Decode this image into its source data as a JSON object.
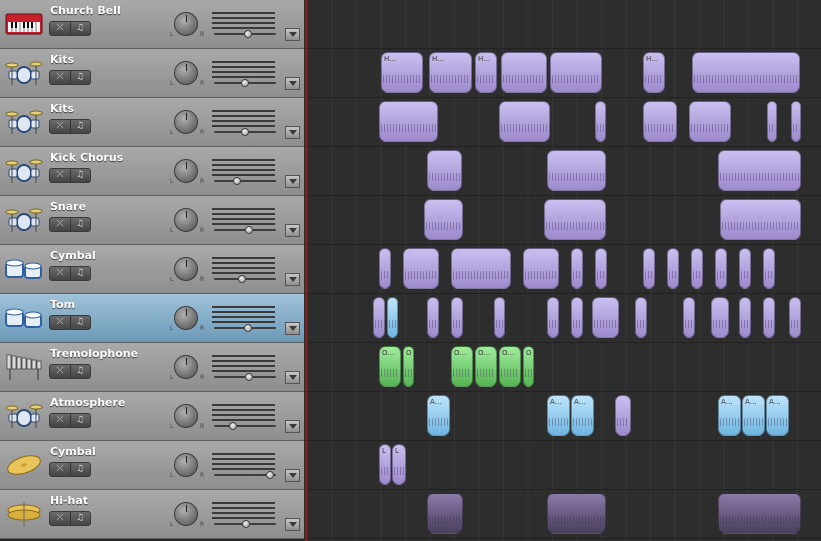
{
  "tracks": [
    {
      "name": "Church Bell",
      "icon": "keyboard-icon",
      "volume": 0.55,
      "selected": false
    },
    {
      "name": "Kits",
      "icon": "drum-kit-icon",
      "volume": 0.5,
      "selected": false
    },
    {
      "name": "Kits",
      "icon": "drum-kit-icon",
      "volume": 0.5,
      "selected": false
    },
    {
      "name": "Kick Chorus",
      "icon": "drum-kit-icon",
      "volume": 0.37,
      "selected": false
    },
    {
      "name": "Snare",
      "icon": "drum-kit-icon",
      "volume": 0.57,
      "selected": false
    },
    {
      "name": "Cymbal",
      "icon": "tom-drums-icon",
      "volume": 0.45,
      "selected": false
    },
    {
      "name": "Tom",
      "icon": "tom-drums-icon",
      "volume": 0.55,
      "selected": true
    },
    {
      "name": "Tremolophone",
      "icon": "vibraphone-icon",
      "volume": 0.57,
      "selected": false
    },
    {
      "name": "Atmosphere",
      "icon": "drum-kit-icon",
      "volume": 0.3,
      "selected": false
    },
    {
      "name": "Cymbal",
      "icon": "cymbal-icon",
      "volume": 0.9,
      "selected": false
    },
    {
      "name": "Hi-hat",
      "icon": "hi-hat-icon",
      "volume": 0.52,
      "selected": false
    }
  ],
  "controls": {
    "mute_glyph": "⤫",
    "solo_glyph": "♫",
    "pan_left": "L",
    "pan_right": "R"
  },
  "colors": {
    "purple": "#b3a3e3",
    "dark": "#5e5070",
    "green": "#7fd17c",
    "blue": "#93cbee",
    "playhead": "#8b1c1c"
  },
  "lanes": [
    [],
    [
      {
        "start": 74,
        "end": 116,
        "color": "purple",
        "label": "H…"
      },
      {
        "start": 122,
        "end": 165,
        "color": "purple",
        "label": "H…"
      },
      {
        "start": 168,
        "end": 190,
        "color": "purple",
        "label": "H…"
      },
      {
        "start": 194,
        "end": 240,
        "color": "purple",
        "label": ""
      },
      {
        "start": 243,
        "end": 295,
        "color": "purple",
        "label": ""
      },
      {
        "start": 336,
        "end": 358,
        "color": "purple",
        "label": "H…"
      },
      {
        "start": 385,
        "end": 493,
        "color": "purple",
        "label": ""
      }
    ],
    [
      {
        "start": 72,
        "end": 131,
        "color": "purple",
        "label": ""
      },
      {
        "start": 192,
        "end": 243,
        "color": "purple",
        "label": ""
      },
      {
        "start": 288,
        "end": 299,
        "color": "purple",
        "label": ""
      },
      {
        "start": 336,
        "end": 370,
        "color": "purple",
        "label": ""
      },
      {
        "start": 382,
        "end": 424,
        "color": "purple",
        "label": ""
      },
      {
        "start": 460,
        "end": 470,
        "color": "purple",
        "label": ""
      },
      {
        "start": 484,
        "end": 494,
        "color": "purple",
        "label": ""
      }
    ],
    [
      {
        "start": 120,
        "end": 155,
        "color": "purple",
        "label": ""
      },
      {
        "start": 240,
        "end": 299,
        "color": "purple",
        "label": ""
      },
      {
        "start": 411,
        "end": 494,
        "color": "purple",
        "label": ""
      }
    ],
    [
      {
        "start": 117,
        "end": 156,
        "color": "purple",
        "label": ""
      },
      {
        "start": 237,
        "end": 299,
        "color": "purple",
        "label": ""
      },
      {
        "start": 413,
        "end": 494,
        "color": "purple",
        "label": ""
      }
    ],
    [
      {
        "start": 72,
        "end": 84,
        "color": "purple",
        "label": ""
      },
      {
        "start": 96,
        "end": 132,
        "color": "purple",
        "label": ""
      },
      {
        "start": 144,
        "end": 204,
        "color": "purple",
        "label": ""
      },
      {
        "start": 216,
        "end": 252,
        "color": "purple",
        "label": ""
      },
      {
        "start": 264,
        "end": 276,
        "color": "purple",
        "label": ""
      },
      {
        "start": 288,
        "end": 300,
        "color": "purple",
        "label": ""
      },
      {
        "start": 336,
        "end": 348,
        "color": "purple",
        "label": ""
      },
      {
        "start": 360,
        "end": 372,
        "color": "purple",
        "label": ""
      },
      {
        "start": 384,
        "end": 396,
        "color": "purple",
        "label": ""
      },
      {
        "start": 408,
        "end": 420,
        "color": "purple",
        "label": ""
      },
      {
        "start": 432,
        "end": 444,
        "color": "purple",
        "label": ""
      },
      {
        "start": 456,
        "end": 468,
        "color": "purple",
        "label": ""
      }
    ],
    [
      {
        "start": 66,
        "end": 78,
        "color": "purple",
        "label": ""
      },
      {
        "start": 80,
        "end": 91,
        "color": "blue",
        "label": ""
      },
      {
        "start": 120,
        "end": 132,
        "color": "purple",
        "label": ""
      },
      {
        "start": 144,
        "end": 156,
        "color": "purple",
        "label": ""
      },
      {
        "start": 187,
        "end": 198,
        "color": "purple",
        "label": ""
      },
      {
        "start": 240,
        "end": 252,
        "color": "purple",
        "label": ""
      },
      {
        "start": 264,
        "end": 276,
        "color": "purple",
        "label": ""
      },
      {
        "start": 285,
        "end": 312,
        "color": "purple",
        "label": ""
      },
      {
        "start": 328,
        "end": 340,
        "color": "purple",
        "label": ""
      },
      {
        "start": 376,
        "end": 388,
        "color": "purple",
        "label": ""
      },
      {
        "start": 404,
        "end": 422,
        "color": "purple",
        "label": ""
      },
      {
        "start": 432,
        "end": 444,
        "color": "purple",
        "label": ""
      },
      {
        "start": 456,
        "end": 468,
        "color": "purple",
        "label": ""
      },
      {
        "start": 482,
        "end": 494,
        "color": "purple",
        "label": ""
      }
    ],
    [
      {
        "start": 72,
        "end": 94,
        "color": "green",
        "label": "O…"
      },
      {
        "start": 96,
        "end": 107,
        "color": "green",
        "label": "O"
      },
      {
        "start": 144,
        "end": 166,
        "color": "green",
        "label": "O…"
      },
      {
        "start": 168,
        "end": 190,
        "color": "green",
        "label": "O…"
      },
      {
        "start": 192,
        "end": 214,
        "color": "green",
        "label": "O…"
      },
      {
        "start": 216,
        "end": 227,
        "color": "green",
        "label": "O"
      }
    ],
    [
      {
        "start": 120,
        "end": 143,
        "color": "blue",
        "label": "A…"
      },
      {
        "start": 240,
        "end": 263,
        "color": "blue",
        "label": "A…"
      },
      {
        "start": 264,
        "end": 287,
        "color": "blue",
        "label": "A…"
      },
      {
        "start": 308,
        "end": 324,
        "color": "purple",
        "label": ""
      },
      {
        "start": 411,
        "end": 434,
        "color": "blue",
        "label": "A…"
      },
      {
        "start": 435,
        "end": 458,
        "color": "blue",
        "label": "A…"
      },
      {
        "start": 459,
        "end": 482,
        "color": "blue",
        "label": "A…"
      }
    ],
    [
      {
        "start": 72,
        "end": 84,
        "color": "purple",
        "label": "L"
      },
      {
        "start": 85,
        "end": 99,
        "color": "purple",
        "label": "L"
      }
    ],
    [
      {
        "start": 120,
        "end": 156,
        "color": "dark",
        "label": ""
      },
      {
        "start": 240,
        "end": 299,
        "color": "dark",
        "label": ""
      },
      {
        "start": 411,
        "end": 494,
        "color": "dark",
        "label": ""
      }
    ]
  ]
}
